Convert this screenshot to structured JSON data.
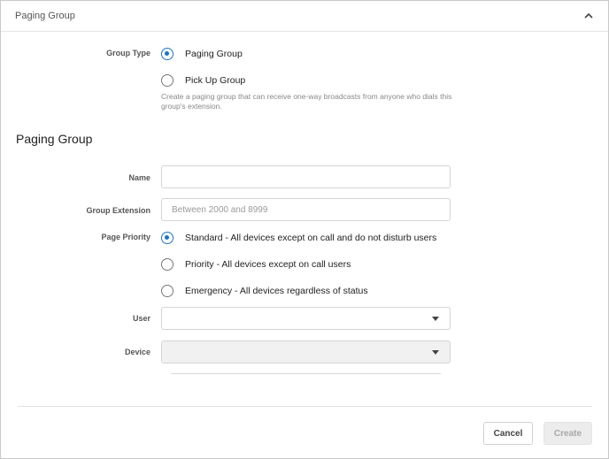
{
  "header": {
    "title": "Paging Group",
    "collapse_icon": "chevron-up-icon"
  },
  "group_type": {
    "label": "Group Type",
    "options": [
      {
        "label": "Paging Group",
        "selected": true
      },
      {
        "label": "Pick Up Group",
        "selected": false
      }
    ],
    "helper_text": "Create a paging group that can receive one-way broadcasts from anyone who dials this group's extension."
  },
  "section": {
    "title": "Paging Group"
  },
  "name": {
    "label": "Name",
    "value": "",
    "placeholder": ""
  },
  "extension": {
    "label": "Group Extension",
    "value": "",
    "placeholder": "Between 2000 and 8999"
  },
  "priority": {
    "label": "Page Priority",
    "options": [
      {
        "label": "Standard - All devices except on call and do not disturb users",
        "selected": true
      },
      {
        "label": "Priority - All devices except on call users",
        "selected": false
      },
      {
        "label": "Emergency - All devices regardless of status",
        "selected": false
      }
    ]
  },
  "user": {
    "label": "User",
    "value": ""
  },
  "device": {
    "label": "Device",
    "value": "",
    "disabled": true
  },
  "footer": {
    "cancel_label": "Cancel",
    "create_label": "Create",
    "create_disabled": true
  },
  "colors": {
    "accent": "#1a73c8",
    "border": "#d4d4d4",
    "disabled_bg": "#ececec"
  }
}
